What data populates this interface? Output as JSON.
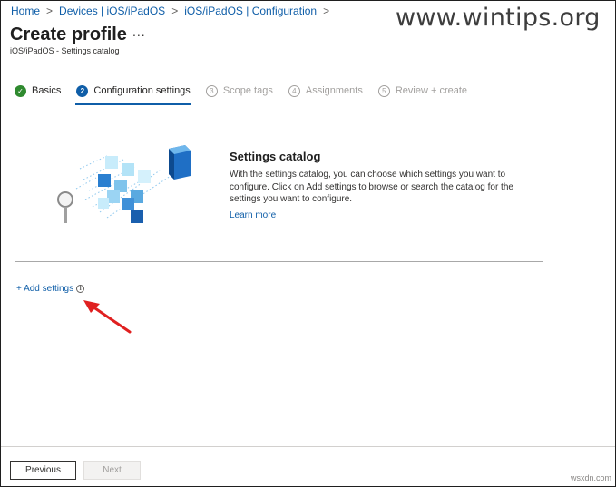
{
  "breadcrumb": {
    "items": [
      "Home",
      "Devices | iOS/iPadOS",
      "iOS/iPadOS | Configuration"
    ],
    "separator": ">"
  },
  "watermark": "www.wintips.org",
  "header": {
    "title": "Create profile",
    "more": "...",
    "subtitle": "iOS/iPadOS - Settings catalog"
  },
  "steps": [
    {
      "number": "✓",
      "label": "Basics",
      "state": "done"
    },
    {
      "number": "2",
      "label": "Configuration settings",
      "state": "active"
    },
    {
      "number": "3",
      "label": "Scope tags",
      "state": "pending"
    },
    {
      "number": "4",
      "label": "Assignments",
      "state": "pending"
    },
    {
      "number": "5",
      "label": "Review + create",
      "state": "pending"
    }
  ],
  "catalog": {
    "title": "Settings catalog",
    "description": "With the settings catalog, you can choose which settings you want to configure. Click on Add settings to browse or search the catalog for the settings you want to configure.",
    "learn_more": "Learn more"
  },
  "add_settings": {
    "label": "+ Add settings",
    "info_icon": "i"
  },
  "footer": {
    "previous": "Previous",
    "next": "Next"
  },
  "corner_watermark": "wsxdn.com",
  "colors": {
    "link": "#0f5ea8",
    "done": "#2f8a2f",
    "arrow": "#e02020"
  }
}
